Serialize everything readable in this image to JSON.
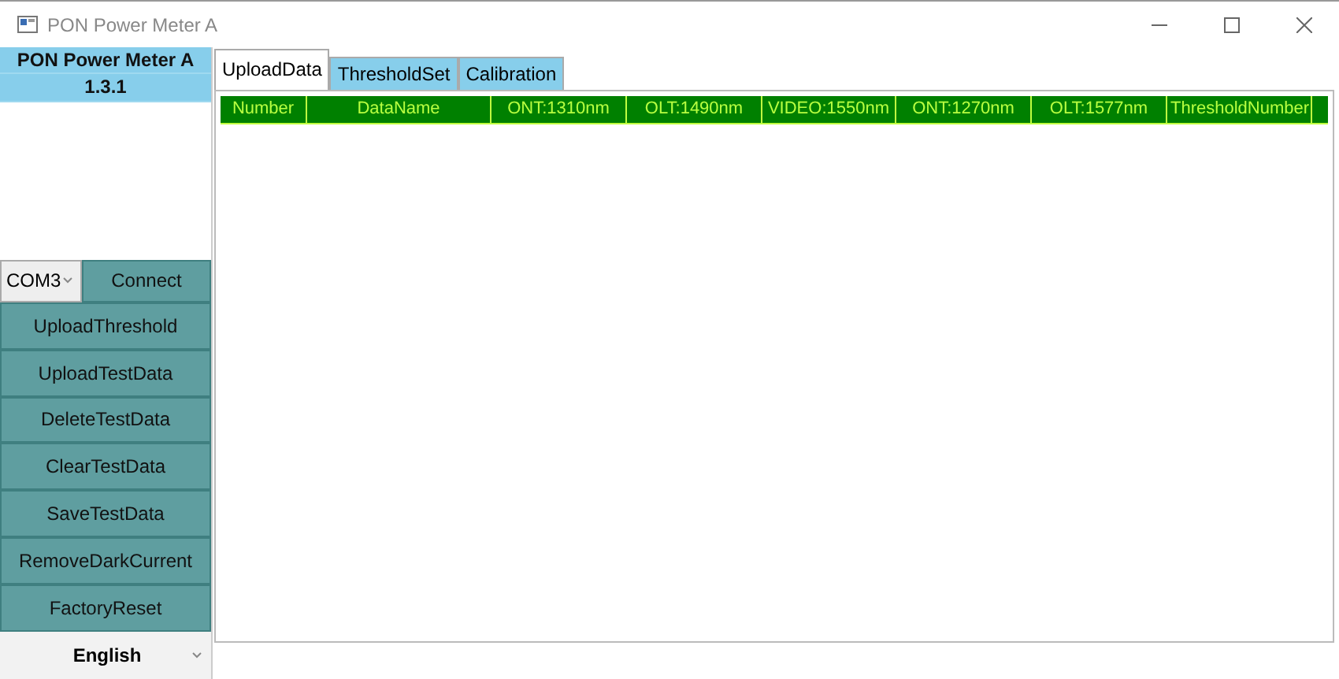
{
  "window": {
    "title": "PON Power Meter A"
  },
  "sidebar": {
    "app_name": "PON Power Meter A",
    "version": "1.3.1",
    "port": {
      "value": "COM3"
    },
    "connect_button": "Connect",
    "buttons": [
      "UploadThreshold",
      "UploadTestData",
      "DeleteTestData",
      "ClearTestData",
      "SaveTestData",
      "RemoveDarkCurrent",
      "FactoryReset"
    ],
    "language": {
      "value": "English"
    }
  },
  "tabs": [
    {
      "label": "UploadData",
      "selected": true
    },
    {
      "label": "ThresholdSet",
      "selected": false
    },
    {
      "label": "Calibration",
      "selected": false
    }
  ],
  "table": {
    "columns": [
      "Number",
      "DataName",
      "ONT:1310nm",
      "OLT:1490nm",
      "VIDEO:1550nm",
      "ONT:1270nm",
      "OLT:1577nm",
      "ThresholdNumber"
    ]
  }
}
